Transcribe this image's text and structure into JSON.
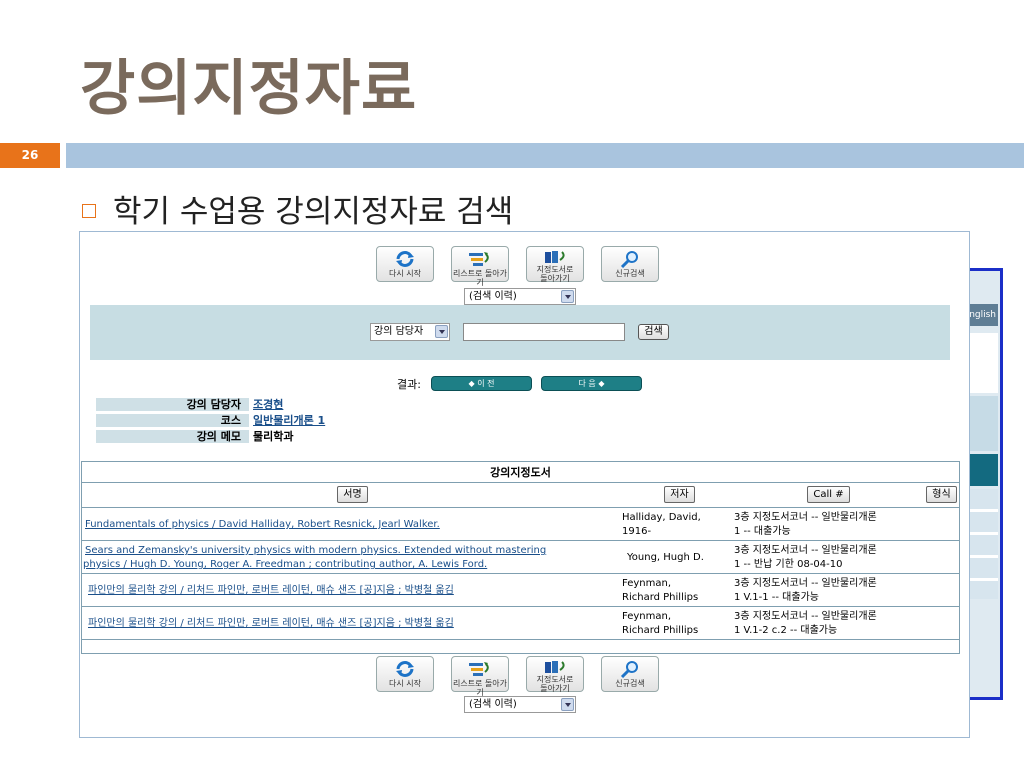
{
  "slide": {
    "title": "강의지정자료",
    "page_number": "26",
    "bullet": "학기 수업용 강의지정자료 검색",
    "accent_color": "#e8731a",
    "bar_color": "#a9c4de"
  },
  "background_window": {
    "english_label": "nglish"
  },
  "toolbar": {
    "restart": "다시 시작",
    "back_to_list": "리스트로 돌아가기",
    "back_to_reserve_1": "지정도서로",
    "back_to_reserve_2": "돌아가기",
    "new_search": "신규검색",
    "history_select": "(검색 이력)"
  },
  "search": {
    "field_select": "강의 담당자",
    "input_value": "",
    "submit_label": "검색"
  },
  "results_nav": {
    "label": "결과:",
    "prev": "◆ 이 전",
    "next": "다 음 ◆"
  },
  "course_info": [
    {
      "key": "강의 담당자",
      "value": "조경현",
      "link": true
    },
    {
      "key": "코스",
      "value": "일반물리개론 1",
      "link": true
    },
    {
      "key": "강의 메모",
      "value": "물리학과",
      "link": false
    }
  ],
  "reserve_table": {
    "caption": "강의지정도서",
    "headers": {
      "title": "서명",
      "author": "저자",
      "call": "Call #",
      "format": "형식"
    },
    "rows": [
      {
        "title_1": "Fundamentals of physics / David Halliday, Robert Resnick, Jearl Walker.",
        "title_2": "",
        "author_1": " Halliday, David,",
        "author_2": "1916-",
        "call_1": "3층 지정도서코너 -- 일반물리개론",
        "call_2": "1 -- 대출가능"
      },
      {
        "title_1": " Sears and Zemansky's university physics with modern physics. Extended without mastering",
        "title_2": "physics / Hugh D. Young, Roger A. Freedman ; contributing author, A. Lewis Ford.",
        "author_1": "Young, Hugh D.",
        "author_2": "",
        "call_1": "3층 지정도서코너 -- 일반물리개론",
        "call_2": "1 -- 반납 기한 08-04-10"
      },
      {
        "title_1": "파인만의 물리학 강의 / 리처드 파인만, 로버트 레이턴, 매슈 샌즈 [공]지음 ; 박병철 옮김",
        "title_2": "",
        "author_1": " Feynman,",
        "author_2": "Richard Phillips",
        "call_1": "3층 지정도서코너 -- 일반물리개론",
        "call_2": "1 V.1-1 -- 대출가능"
      },
      {
        "title_1": "파인만의 물리학 강의 / 리처드 파인만, 로버트 레이턴, 매슈 샌즈 [공]지음 ; 박병철 옮김",
        "title_2": "",
        "author_1": " Feynman,",
        "author_2": "Richard Phillips",
        "call_1": "3층 지정도서코너 -- 일반물리개론",
        "call_2": "1 V.1-2 c.2 -- 대출가능"
      }
    ]
  }
}
